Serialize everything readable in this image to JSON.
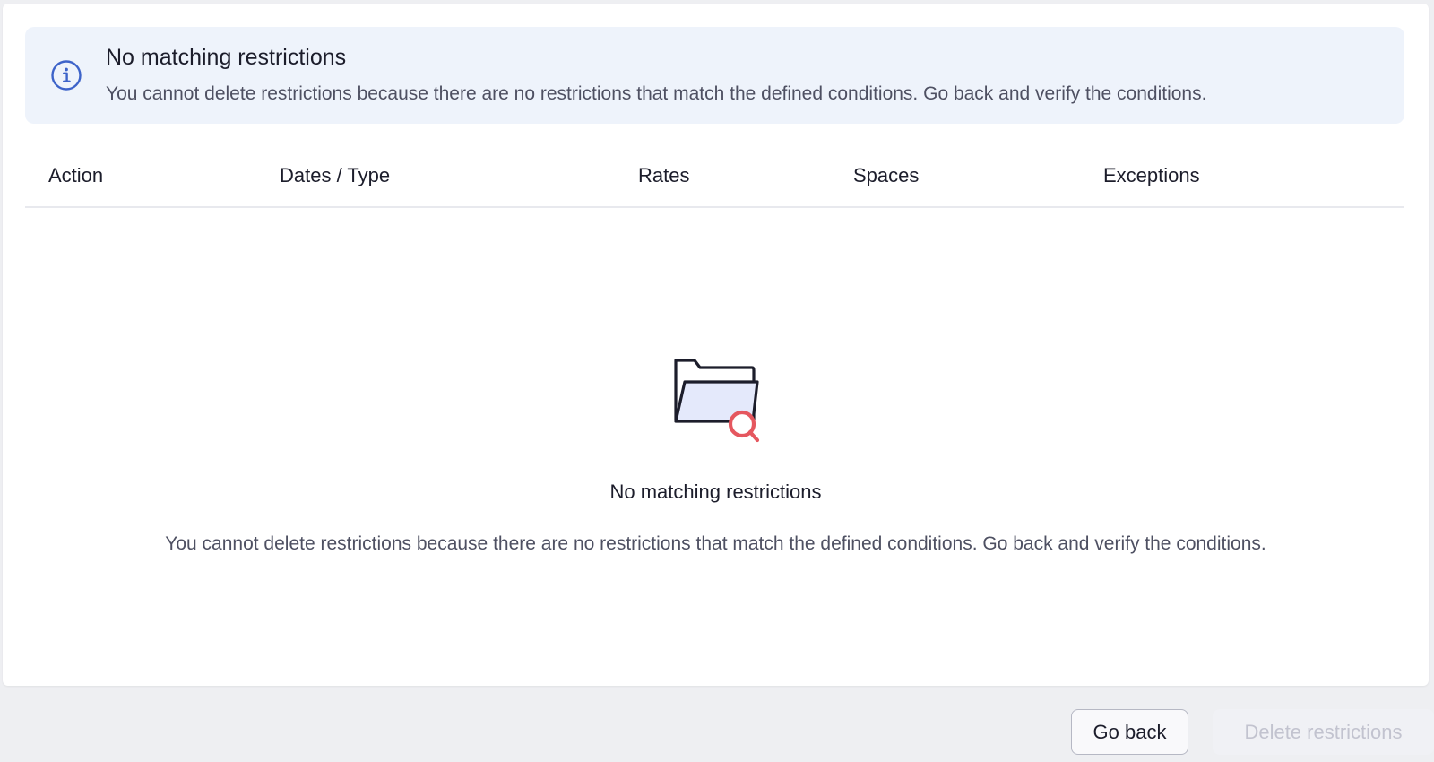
{
  "banner": {
    "title": "No matching restrictions",
    "message": "You cannot delete restrictions because there are no restrictions that match the defined conditions. Go back and verify the conditions.",
    "icon": "info-icon",
    "accent_color": "#3d63c9",
    "background_color": "#eef3fb"
  },
  "table": {
    "columns": [
      "Action",
      "Dates / Type",
      "Rates",
      "Spaces",
      "Exceptions"
    ]
  },
  "empty_state": {
    "icon": "folder-search-icon",
    "title": "No matching restrictions",
    "message": "You cannot delete restrictions because there are no restrictions that match the defined conditions. Go back and verify the conditions.",
    "accent_color": "#e5575f"
  },
  "footer": {
    "back_label": "Go back",
    "delete_label": "Delete restrictions",
    "delete_enabled": false
  }
}
